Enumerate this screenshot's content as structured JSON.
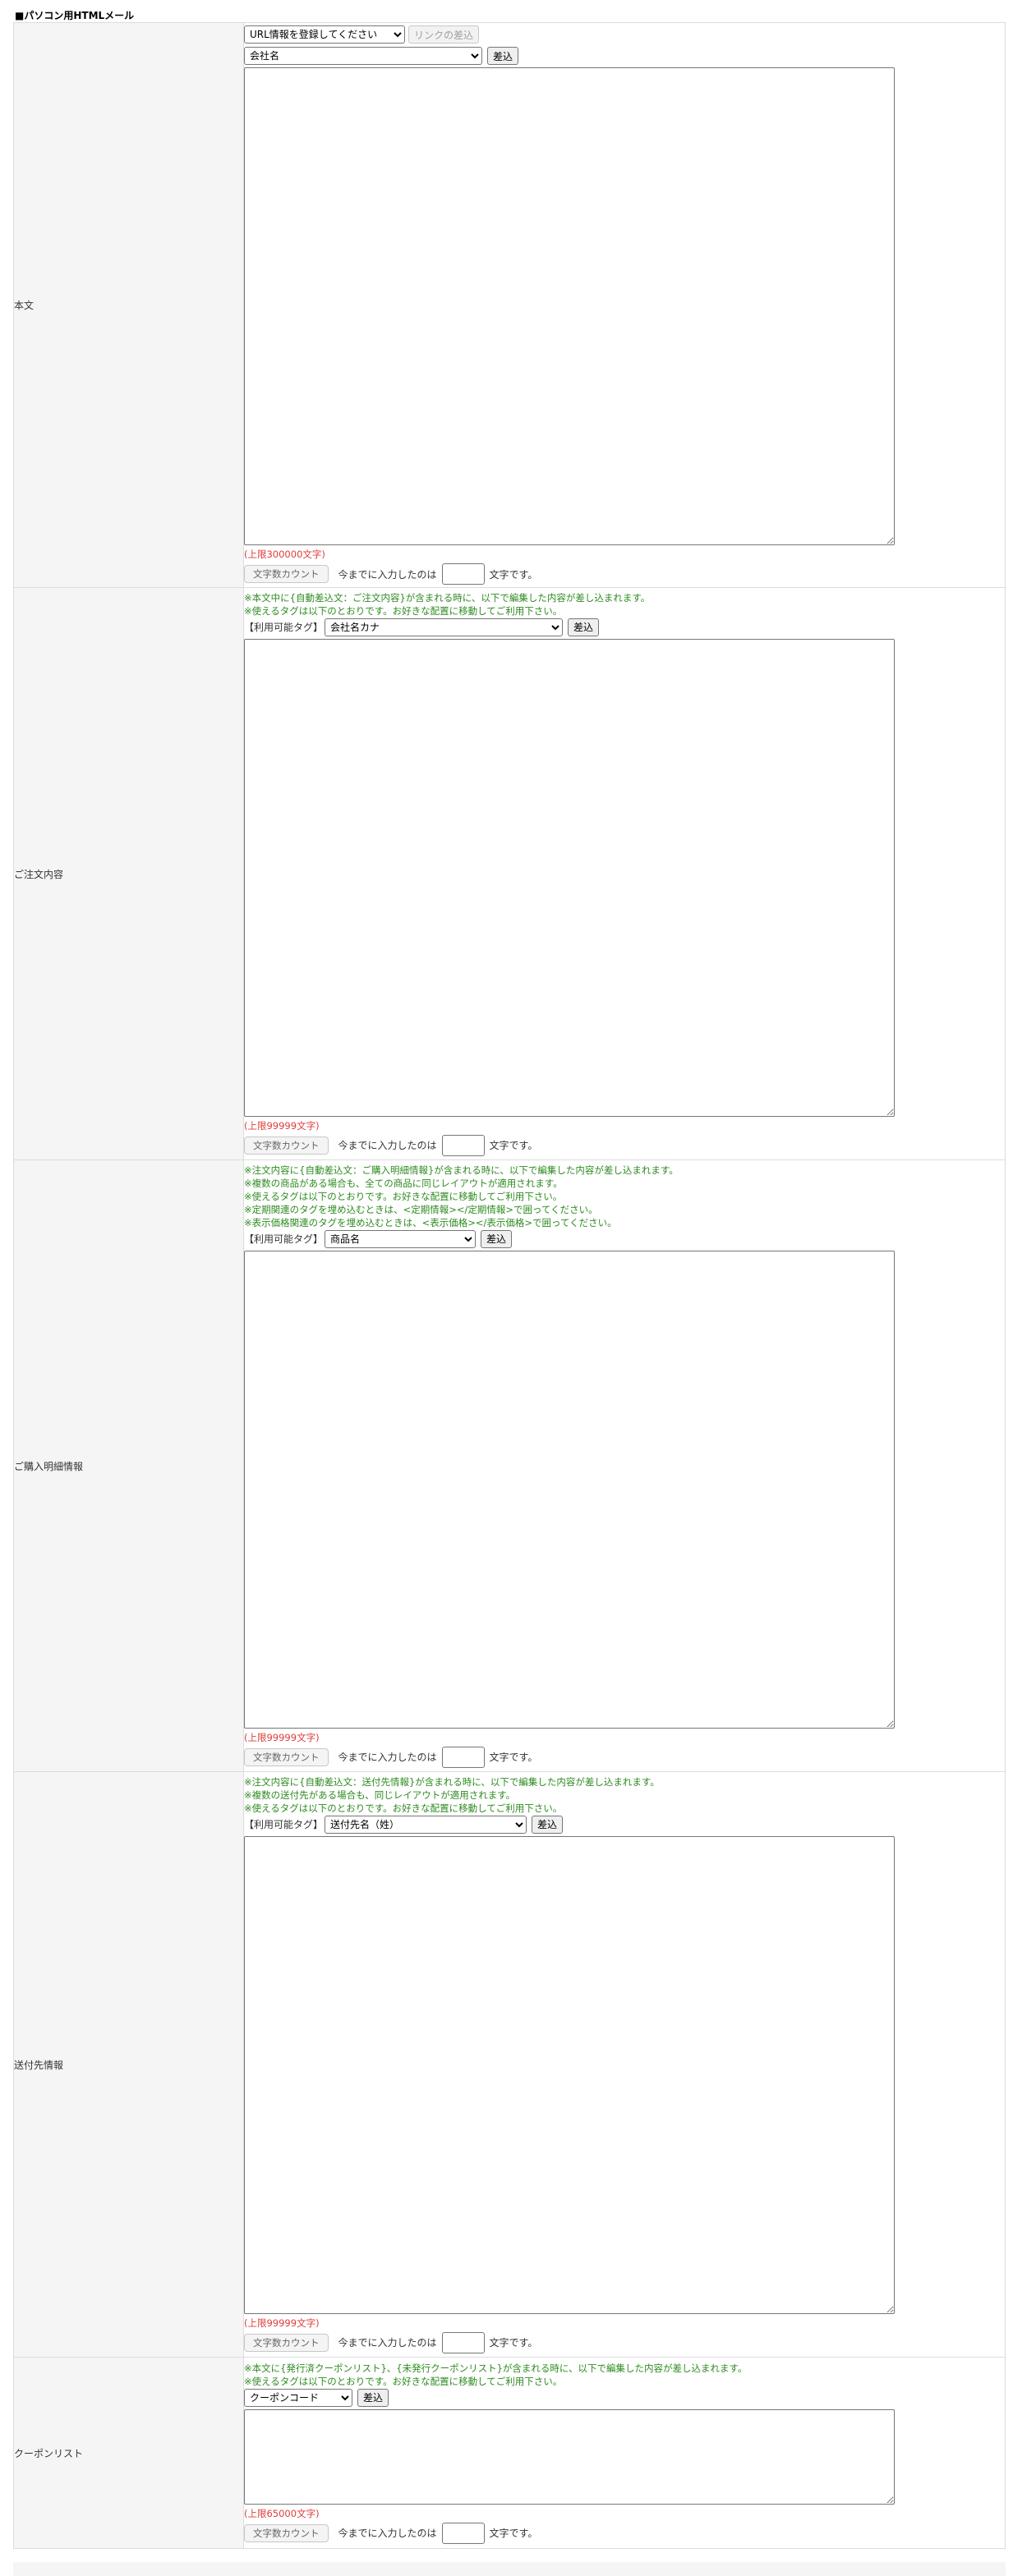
{
  "section_title": "■パソコン用HTMLメール",
  "count_button_label": "文字数カウント",
  "count_prefix": "今までに入力したのは",
  "count_suffix": "文字です。",
  "insert_label": "差込",
  "tag_label": "【利用可能タグ】",
  "honbun": {
    "label": "本文",
    "url_select": "URL情報を登録してください",
    "link_insert_label": "リンクの差込",
    "tag_select": "会社名",
    "limit": "(上限300000文字)"
  },
  "order": {
    "label": "ご注文内容",
    "notes": [
      "※本文中に{自動差込文：ご注文内容}が含まれる時に、以下で編集した内容が差し込まれます。",
      "※使えるタグは以下のとおりです。お好きな配置に移動してご利用下さい。"
    ],
    "tag_select": "会社名カナ",
    "limit": "(上限99999文字)"
  },
  "purchase": {
    "label": "ご購入明細情報",
    "notes": [
      "※注文内容に{自動差込文：ご購入明細情報}が含まれる時に、以下で編集した内容が差し込まれます。",
      "※複数の商品がある場合も、全ての商品に同じレイアウトが適用されます。",
      "※使えるタグは以下のとおりです。お好きな配置に移動してご利用下さい。",
      "※定期関連のタグを埋め込むときは、<定期情報></定期情報>で囲ってください。",
      "※表示価格関連のタグを埋め込むときは、<表示価格></表示価格>で囲ってください。"
    ],
    "tag_select": "商品名",
    "limit": "(上限99999文字)"
  },
  "shipping": {
    "label": "送付先情報",
    "notes": [
      "※注文内容に{自動差込文：送付先情報}が含まれる時に、以下で編集した内容が差し込まれます。",
      "※複数の送付先がある場合も、同じレイアウトが適用されます。",
      "※使えるタグは以下のとおりです。お好きな配置に移動してご利用下さい。"
    ],
    "tag_select": "送付先名（姓）",
    "limit": "(上限99999文字)"
  },
  "coupon": {
    "label": "クーポンリスト",
    "notes": [
      "※本文に{発行済クーポンリスト}、{未発行クーポンリスト}が含まれる時に、以下で編集した内容が差し込まれます。",
      "※使えるタグは以下のとおりです。お好きな配置に移動してご利用下さい。"
    ],
    "tag_select": "クーポンコード",
    "limit": "(上限65000文字)"
  }
}
